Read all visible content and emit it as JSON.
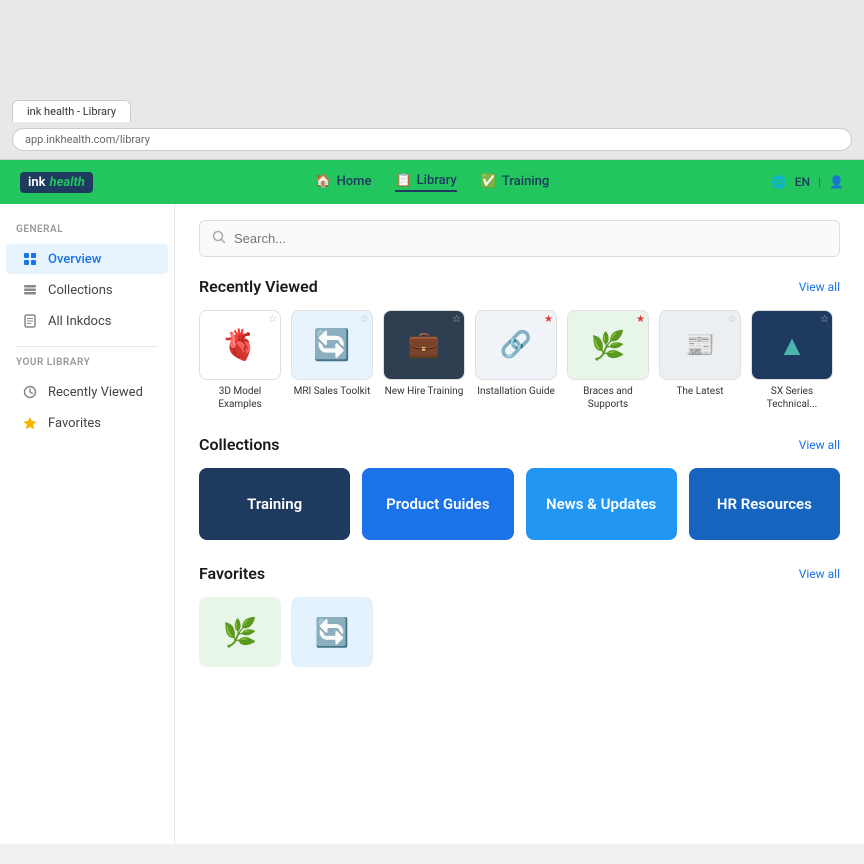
{
  "browser": {
    "tab_label": "ink health - Library",
    "address_bar": "app.inkhealth.com/library"
  },
  "nav": {
    "logo_ink": "ink",
    "logo_health": "health",
    "links": [
      {
        "id": "home",
        "label": "Home",
        "icon": "🏠",
        "active": false
      },
      {
        "id": "library",
        "label": "Library",
        "icon": "📋",
        "active": true
      },
      {
        "id": "training",
        "label": "Training",
        "icon": "✅",
        "active": false
      }
    ],
    "lang_label": "EN",
    "user_icon": "👤"
  },
  "sidebar": {
    "general_label": "General",
    "overview_label": "Overview",
    "collections_label": "Collections",
    "all_inkdocs_label": "All Inkdocs",
    "your_library_label": "Your Library",
    "recently_viewed_label": "Recently Viewed",
    "favorites_label": "Favorites"
  },
  "search": {
    "placeholder": "Search..."
  },
  "recently_viewed": {
    "section_title": "Recently Viewed",
    "view_all": "View all",
    "docs": [
      {
        "id": "3d-model",
        "label": "3D Model Examples",
        "thumb_type": "heart",
        "starred": false,
        "icon": "🫀"
      },
      {
        "id": "mri-sales",
        "label": "MRI Sales Toolkit",
        "thumb_type": "blue",
        "starred": false,
        "icon": "🔄"
      },
      {
        "id": "new-hire",
        "label": "New Hire Training",
        "thumb_type": "dark",
        "starred": false,
        "icon": "💼"
      },
      {
        "id": "installation",
        "label": "Installation Guide",
        "thumb_type": "white",
        "starred": true,
        "icon": "🔗"
      },
      {
        "id": "braces",
        "label": "Braces and Supports",
        "thumb_type": "green",
        "starred": true,
        "icon": "🌿"
      },
      {
        "id": "the-latest",
        "label": "The Latest",
        "thumb_type": "gray",
        "starred": false,
        "icon": "📰"
      },
      {
        "id": "sx-series",
        "label": "SX Series Technical...",
        "thumb_type": "navy",
        "starred": false,
        "icon": "▲"
      }
    ]
  },
  "collections": {
    "section_title": "Collections",
    "view_all": "View all",
    "items": [
      {
        "id": "training",
        "label": "Training",
        "color_class": "collection-training"
      },
      {
        "id": "product-guides",
        "label": "Product Guides",
        "color_class": "collection-product"
      },
      {
        "id": "news-updates",
        "label": "News & Updates",
        "color_class": "collection-news"
      },
      {
        "id": "hr-resources",
        "label": "HR Resources",
        "color_class": "collection-hr"
      }
    ]
  },
  "favorites": {
    "section_title": "Favorites",
    "view_all": "View all",
    "docs": [
      {
        "id": "fav-1",
        "thumb_class": "green",
        "icon": "🌿"
      },
      {
        "id": "fav-2",
        "thumb_class": "blue2",
        "icon": "🔄"
      }
    ]
  }
}
